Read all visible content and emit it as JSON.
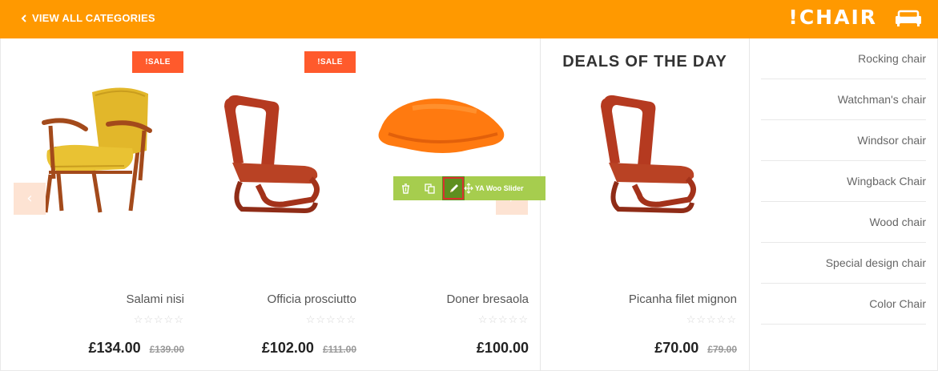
{
  "header": {
    "back_label": "VIEW ALL CATEGORIES",
    "brand": "!CHAIR",
    "brand_icon": "sofa-icon",
    "accent_color": "#ff9900"
  },
  "products": [
    {
      "sale_badge": "!SALE",
      "name": "Salami nisi",
      "rating": "☆☆☆☆☆",
      "price": "£134.00",
      "old_price": "£139.00"
    },
    {
      "sale_badge": "!SALE",
      "name": "Officia prosciutto",
      "rating": "☆☆☆☆☆",
      "price": "£102.00",
      "old_price": "£111.00"
    },
    {
      "name": "Doner bresaola",
      "rating": "☆☆☆☆☆",
      "price": "£100.00"
    }
  ],
  "slider": {
    "prev_icon": "chevron-left-icon",
    "next_icon": "chevron-right-icon"
  },
  "toolbar": {
    "label": "YA Woo Slider",
    "icons": [
      "trash-icon",
      "copy-icon",
      "pencil-icon",
      "move-icon"
    ]
  },
  "deals": {
    "title": "DEALS OF THE DAY",
    "name": "Picanha filet mignon",
    "rating": "☆☆☆☆☆",
    "price": "£70.00",
    "old_price": "£79.00"
  },
  "categories": [
    "Rocking chair",
    "Watchman's chair",
    "Windsor chair",
    "Wingback Chair",
    "Wood chair",
    "Special design chair",
    "Color Chair"
  ]
}
